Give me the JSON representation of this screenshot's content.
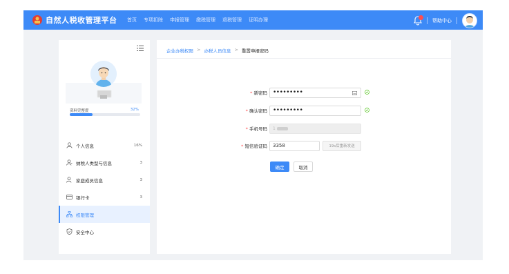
{
  "header": {
    "brand": "自然人税收管理平台",
    "nav": [
      "首页",
      "专项扣除",
      "申报管理",
      "缴税管理",
      "退税管理",
      "证明办理"
    ],
    "help": "帮助中心"
  },
  "sidebar": {
    "completeness_label": "资料完整度",
    "completeness_pct": "32%",
    "completeness_value": 0.32,
    "items": [
      {
        "label": "个人信息",
        "count": "16%"
      },
      {
        "label": "纳税人类型与信息",
        "count": "3"
      },
      {
        "label": "家庭成员信息",
        "count": "3"
      },
      {
        "label": "银行卡",
        "count": "3"
      },
      {
        "label": "权限管理",
        "count": ""
      },
      {
        "label": "安全中心",
        "count": ""
      }
    ]
  },
  "breadcrumb": [
    "企业办税权限",
    "办税人员信息",
    "重置申报密码"
  ],
  "form": {
    "new_password": {
      "label": "新密码",
      "value": "•••••••••"
    },
    "confirm_password": {
      "label": "确认密码",
      "value": "•••••••••"
    },
    "phone": {
      "label": "手机号码",
      "value": "1"
    },
    "sms_code": {
      "label": "短信验证码",
      "value": "3358",
      "resend": "19s后重新发送"
    },
    "confirm_button": "确定",
    "cancel_button": "取消"
  },
  "colors": {
    "accent": "#3d8af7",
    "required": "#ff4d4f",
    "success": "#52c41a"
  }
}
